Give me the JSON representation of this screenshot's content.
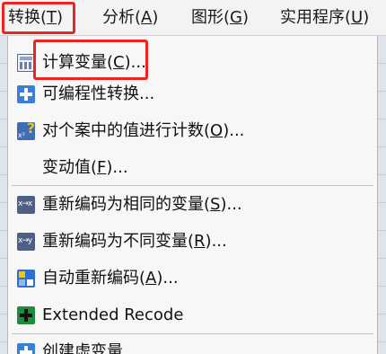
{
  "menubar": {
    "items": [
      {
        "label": "转换(",
        "key": "T",
        "tail": ")"
      },
      {
        "label": "分析(",
        "key": "A",
        "tail": ")"
      },
      {
        "label": "图形(",
        "key": "G",
        "tail": ")"
      },
      {
        "label": "实用程序(",
        "key": "U",
        "tail": ")"
      }
    ]
  },
  "menu": {
    "items": [
      {
        "pre": "计算变量(",
        "key": "C",
        "post": ")...",
        "icon": "calculator-icon"
      },
      {
        "pre": "可编程性转换...",
        "key": "",
        "post": "",
        "icon": "plus-icon"
      },
      {
        "pre": "对个案中的值进行计数(",
        "key": "O",
        "post": ")...",
        "icon": "count-values-icon"
      },
      {
        "pre": "变动值(",
        "key": "F",
        "post": ")...",
        "icon": ""
      },
      {
        "pre": "重新编码为相同的变量(",
        "key": "S",
        "post": ")...",
        "icon": "recode-same-icon"
      },
      {
        "pre": "重新编码为不同变量(",
        "key": "R",
        "post": ")...",
        "icon": "recode-different-icon"
      },
      {
        "pre": "自动重新编码(",
        "key": "A",
        "post": ")...",
        "icon": "auto-recode-icon"
      },
      {
        "pre": "Extended Recode",
        "key": "",
        "post": "",
        "icon": "extended-recode-icon"
      },
      {
        "pre": "创建虚变量",
        "key": "",
        "post": "",
        "icon": "plus-icon"
      }
    ]
  },
  "colors": {
    "highlight": "#e8251f",
    "menu_bg": "#f7f7f7",
    "menubar_bg": "#f3f3f3"
  }
}
